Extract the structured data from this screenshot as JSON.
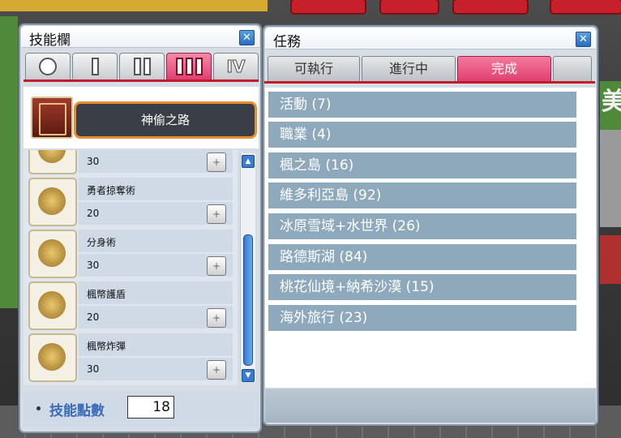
{
  "skill_window": {
    "title": "技能欄",
    "tabs": [
      {
        "label": "○"
      },
      {
        "label": "I"
      },
      {
        "label": "II"
      },
      {
        "label": "III"
      },
      {
        "label": "IV"
      }
    ],
    "active_tab": "III",
    "job_name": "神偷之路",
    "skills": [
      {
        "name": "",
        "level": "30"
      },
      {
        "name": "勇者掠奪術",
        "level": "20"
      },
      {
        "name": "分身術",
        "level": "30"
      },
      {
        "name": "楓幣護盾",
        "level": "20"
      },
      {
        "name": "楓幣炸彈",
        "level": "30"
      }
    ],
    "skill_points_label": "技能點數",
    "skill_points_value": "18"
  },
  "quest_window": {
    "title": "任務",
    "tabs": [
      {
        "label": "可執行"
      },
      {
        "label": "進行中"
      },
      {
        "label": "完成"
      }
    ],
    "active_tab": "完成",
    "categories": [
      {
        "label": "活動 (7)"
      },
      {
        "label": "職業 (4)"
      },
      {
        "label": "楓之島 (16)"
      },
      {
        "label": "維多利亞島 (92)"
      },
      {
        "label": "冰原雪域+水世界 (26)"
      },
      {
        "label": "路德斯湖 (84)"
      },
      {
        "label": "桃花仙境+納希沙漠 (15)"
      },
      {
        "label": "海外旅行 (23)"
      }
    ]
  },
  "colors": {
    "active_tab": "#e04070",
    "quest_row": "#8ea9bc",
    "accent_red": "#c21c2c",
    "skill_points_label": "#3a6ab8"
  },
  "icons": {
    "close": "close-icon",
    "scroll_up": "arrow-up-icon",
    "scroll_down": "arrow-down-icon"
  }
}
